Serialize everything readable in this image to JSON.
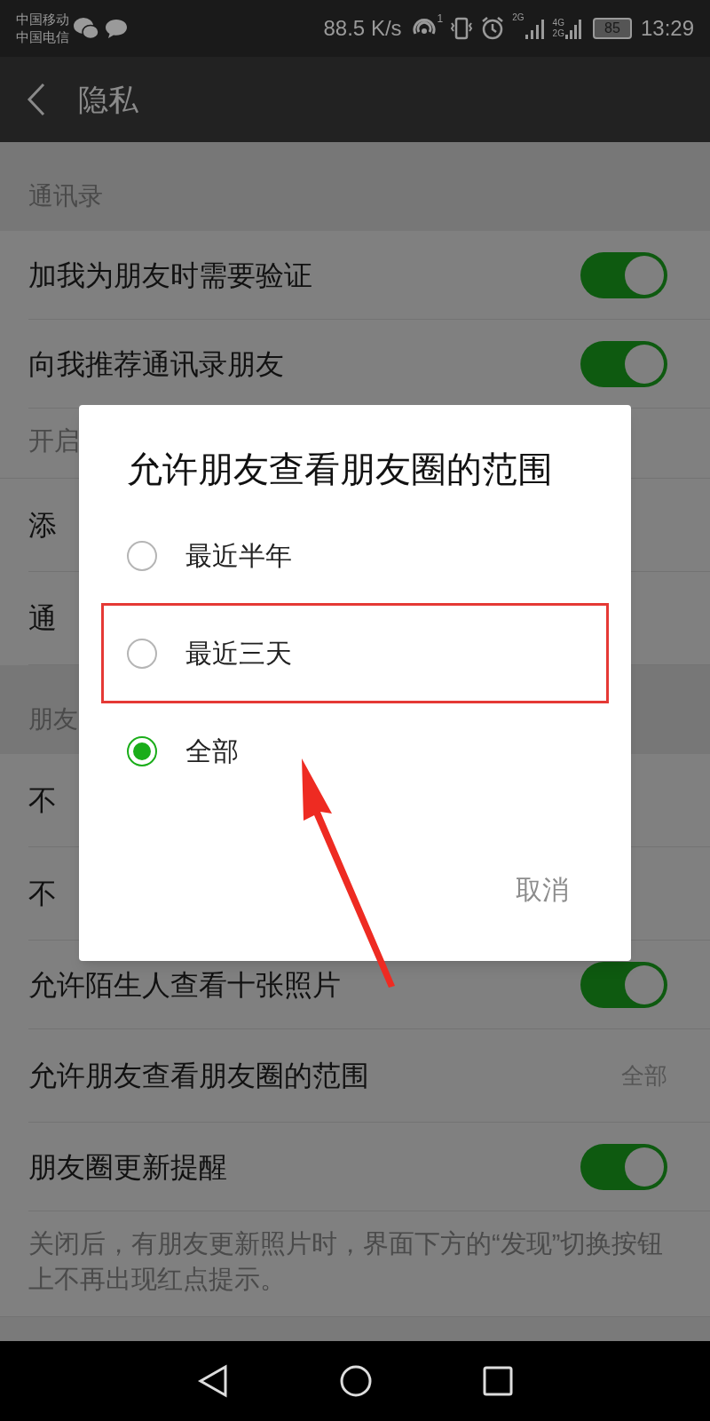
{
  "status_bar": {
    "carriers": [
      "中国移动",
      "中国电信"
    ],
    "speed": "88.5 K/s",
    "sim_mark": "1",
    "network_top": "2G",
    "network_mid": "4G",
    "network_low": "2G",
    "battery": "85",
    "time": "13:29"
  },
  "header": {
    "title": "隐私"
  },
  "list": [
    {
      "kind": "section",
      "text": "通讯录"
    },
    {
      "kind": "toggle",
      "text": "加我为朋友时需要验证",
      "on": true
    },
    {
      "kind": "toggle",
      "text": "向我推荐通讯录朋友",
      "on": true
    },
    {
      "kind": "hint",
      "text": "开启"
    },
    {
      "kind": "plain",
      "text": "添"
    },
    {
      "kind": "plain",
      "text": "通"
    },
    {
      "kind": "section",
      "text": "朋友"
    },
    {
      "kind": "plain",
      "text": "不"
    },
    {
      "kind": "plain",
      "text": "不"
    },
    {
      "kind": "toggle",
      "text": "允许陌生人查看十张照片",
      "on": true
    },
    {
      "kind": "value",
      "text": "允许朋友查看朋友圈的范围",
      "value": "全部"
    },
    {
      "kind": "toggle",
      "text": "朋友圈更新提醒",
      "on": true
    },
    {
      "kind": "hint",
      "text": "关闭后，有朋友更新照片时，界面下方的“发现”切换按钮上不再出现红点提示。"
    }
  ],
  "dialog": {
    "title": "允许朋友查看朋友圈的范围",
    "options": [
      {
        "label": "最近半年",
        "selected": false,
        "highlighted": false
      },
      {
        "label": "最近三天",
        "selected": false,
        "highlighted": true
      },
      {
        "label": "全部",
        "selected": true,
        "highlighted": false
      }
    ],
    "cancel": "取消"
  }
}
